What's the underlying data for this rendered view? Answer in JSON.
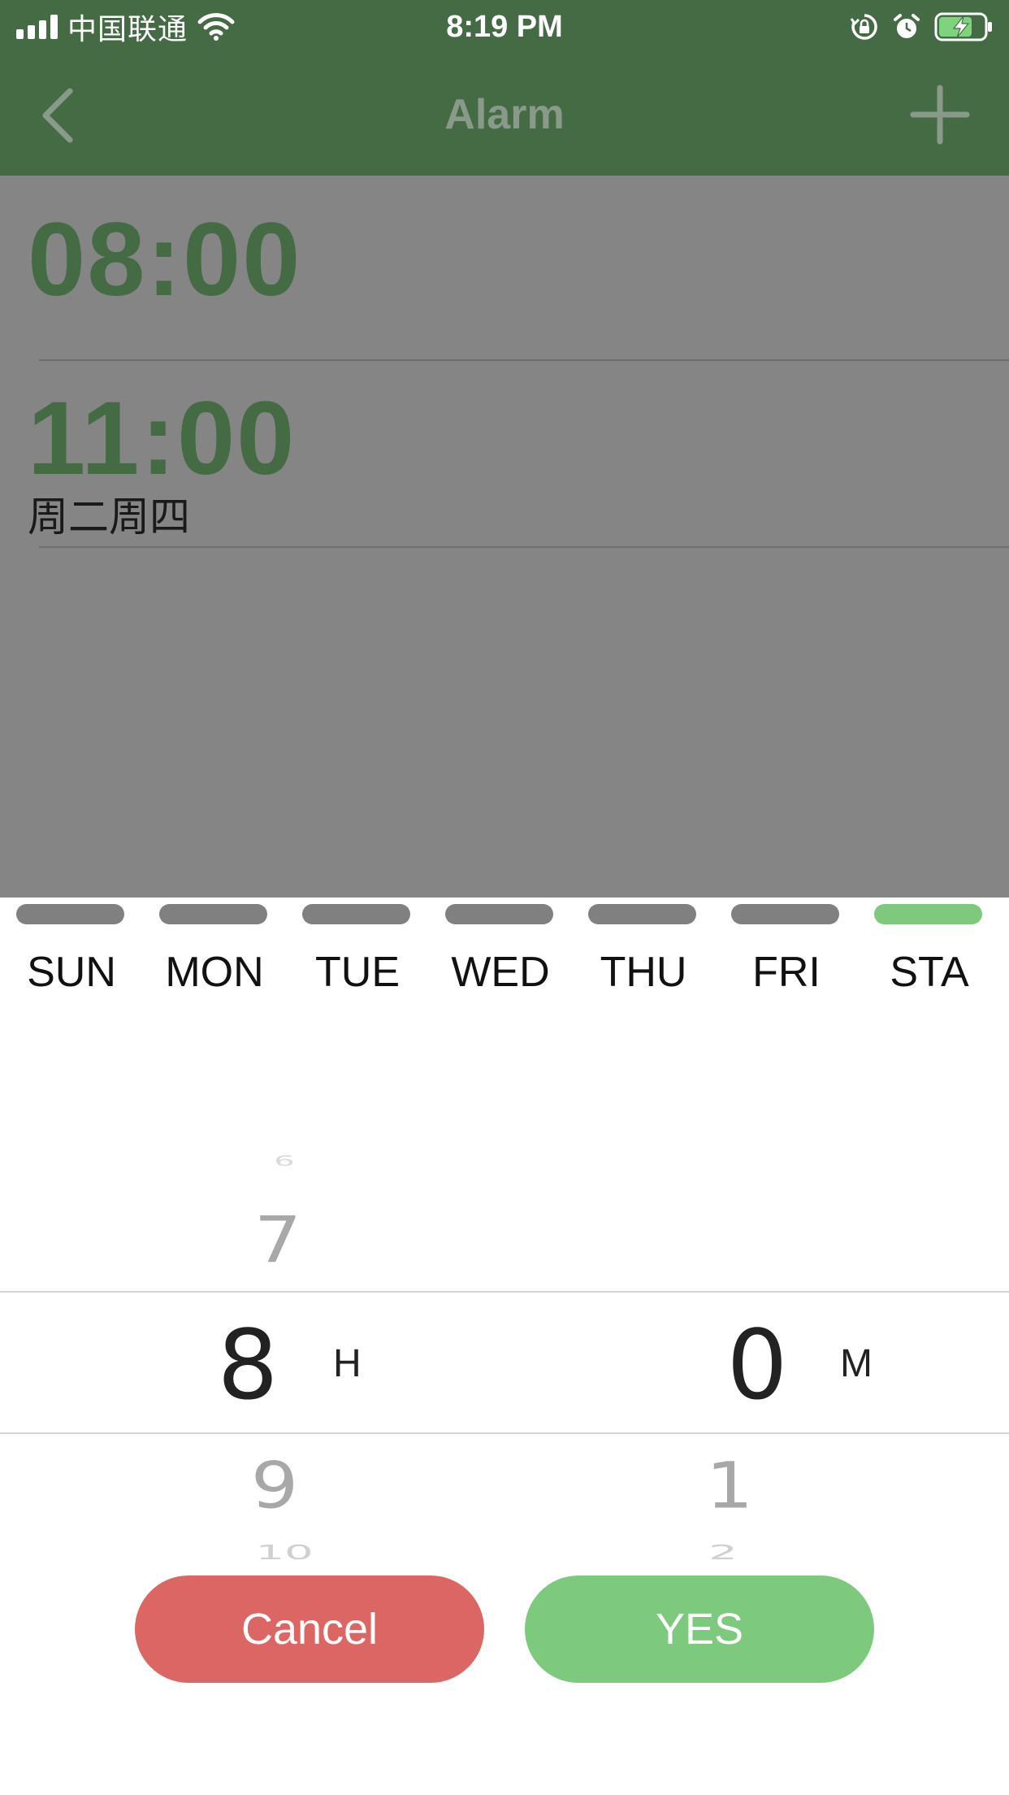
{
  "status_bar": {
    "carrier": "中国联通",
    "time": "8:19 PM"
  },
  "nav": {
    "title": "Alarm",
    "back_icon": "chevron-left-icon",
    "add_icon": "plus-icon"
  },
  "alarms": [
    {
      "time": "08:00",
      "days": ""
    },
    {
      "time": "11:00",
      "days": "周二周四"
    }
  ],
  "day_selector": [
    {
      "label": "SUN",
      "selected": false
    },
    {
      "label": "MON",
      "selected": false
    },
    {
      "label": "TUE",
      "selected": false
    },
    {
      "label": "WED",
      "selected": false
    },
    {
      "label": "THU",
      "selected": false
    },
    {
      "label": "FRI",
      "selected": false
    },
    {
      "label": "STA",
      "selected": true
    }
  ],
  "time_picker": {
    "hour": {
      "above2": "6",
      "above1": "7",
      "selected": "8",
      "below1": "9",
      "below2": "10",
      "unit": "H"
    },
    "minute": {
      "selected": "0",
      "below1": "1",
      "below2": "2",
      "unit": "M"
    }
  },
  "buttons": {
    "cancel": "Cancel",
    "yes": "YES"
  },
  "colors": {
    "header_green": "#456b45",
    "overlay_gray": "#858585",
    "selected_day": "#7fc97f",
    "cancel_red": "#dc6663",
    "yes_green": "#7dc97d"
  }
}
